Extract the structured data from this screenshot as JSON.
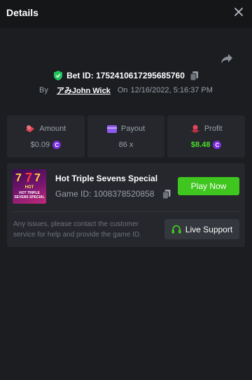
{
  "header": {
    "title": "Details"
  },
  "bet": {
    "id_label": "Bet ID: 1752410617295685760",
    "by_label": "By",
    "username": "アみJohn Wick",
    "on_label": "On",
    "timestamp": "12/16/2022, 5:16:37 PM"
  },
  "stats": {
    "amount": {
      "label": "Amount",
      "value": "$0.09",
      "icon": "bet-chips-icon",
      "color": "#e0485a"
    },
    "payout": {
      "label": "Payout",
      "value": "86 x",
      "icon": "wallet-icon",
      "color": "#8e5cf0"
    },
    "profit": {
      "label": "Profit",
      "value": "$8.48",
      "icon": "coins-icon",
      "color": "#e0485a"
    }
  },
  "coin_symbol": "C",
  "game": {
    "thumb": {
      "top_text": "HOT",
      "sub_text": "HOT TRIPLE SEVENS SPECIAL"
    },
    "title": "Hot Triple Sevens Special",
    "id_label": "Game ID: 1008378520858",
    "play_label": "Play Now",
    "notice": "Any issues, please contact the customer service for help and provide the game ID.",
    "support_label": "Live Support"
  },
  "colors": {
    "accent_green": "#3fc61f",
    "profit_green": "#4ade2e",
    "coin_purple": "#7b2fe0",
    "shield_green": "#22c55e"
  }
}
